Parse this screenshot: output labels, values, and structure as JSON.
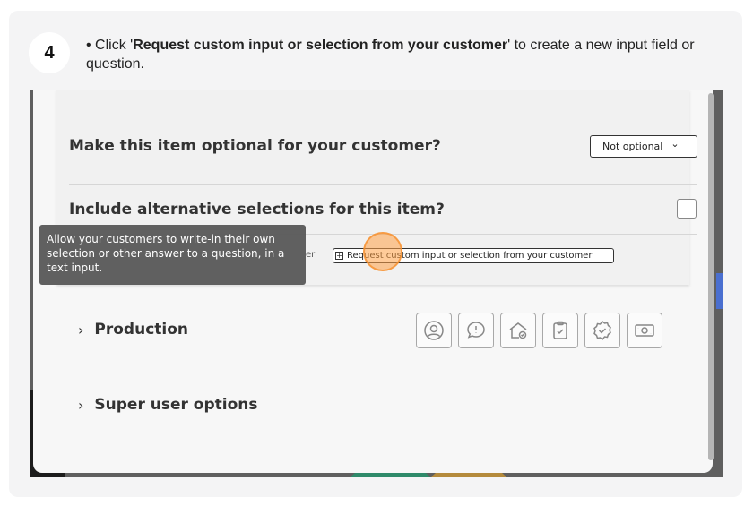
{
  "step": {
    "number": "4",
    "bullet": "• Click '",
    "action_bold": "Request custom input or selection from your customer",
    "rest": "' to create a new input field or question."
  },
  "screen": {
    "optional_row": {
      "label": "Make this item optional for your customer?",
      "select_value": "Not optional",
      "select_arrow": "⌄"
    },
    "alternatives_row": {
      "label": "Include alternative selections for this item?",
      "checked": false
    },
    "tooltip": "Allow your customers to write-in their own selection or other answer to a question, in a text input.",
    "hidden_text_fragment": "er",
    "request_button": {
      "plus": "+",
      "label": "Request custom input or selection from your customer"
    },
    "sections": [
      {
        "chevron": "›",
        "label": "Production"
      },
      {
        "chevron": "›",
        "label": "Super user options"
      }
    ],
    "production_icons": [
      "person-circle-icon",
      "speech-bubble-icon",
      "house-check-icon",
      "clipboard-check-icon",
      "badge-check-icon",
      "money-bill-icon"
    ],
    "colors": {
      "highlight": "#f5a04a",
      "tooltip_bg": "#5a5a5a",
      "panel": "#f7f7f7"
    }
  }
}
